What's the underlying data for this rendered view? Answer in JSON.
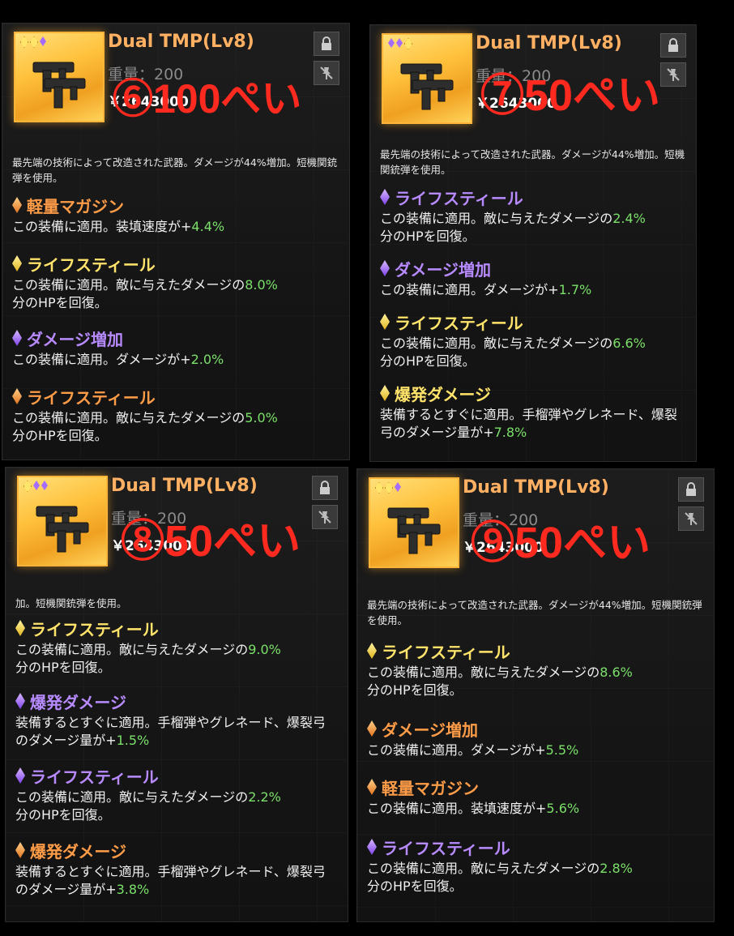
{
  "cards": [
    {
      "name": "Dual TMP(Lv8)",
      "weight": "重量：200",
      "price": "￥2643000",
      "annotation": "⑥100ぺい",
      "description": "最先端の技術によって改造された武器。ダメージが44%増加。短機関銃弾を使用。",
      "perks": [
        {
          "title": "軽量マガジン",
          "gem": "orange",
          "pre": "この装備に適用。装填速度が+",
          "value": "4.4%",
          "post": ""
        },
        {
          "title": "ライフスティール",
          "gem": "yellow",
          "pre": "この装備に適用。敵に与えたダメージの",
          "value": "8.0%",
          "post": "分のHPを回復。"
        },
        {
          "title": "ダメージ増加",
          "gem": "purple",
          "pre": "この装備に適用。ダメージが+",
          "value": "2.0%",
          "post": ""
        },
        {
          "title": "ライフスティール",
          "gem": "orange",
          "pre": "この装備に適用。敵に与えたダメージの",
          "value": "5.0%",
          "post": "分のHPを回復。"
        }
      ]
    },
    {
      "name": "Dual TMP(Lv8)",
      "weight": "重量：200",
      "price": "￥2643000",
      "annotation": "⑦50ぺい",
      "description": "最先端の技術によって改造された武器。ダメージが44%増加。短機関銃弾を使用。",
      "perks": [
        {
          "title": "ライフスティール",
          "gem": "purple",
          "pre": "この装備に適用。敵に与えたダメージの",
          "value": "2.4%",
          "post": "分のHPを回復。"
        },
        {
          "title": "ダメージ増加",
          "gem": "purple",
          "pre": "この装備に適用。ダメージが+",
          "value": "1.7%",
          "post": ""
        },
        {
          "title": "ライフスティール",
          "gem": "yellow",
          "pre": "この装備に適用。敵に与えたダメージの",
          "value": "6.6%",
          "post": "分のHPを回復。"
        },
        {
          "title": "爆発ダメージ",
          "gem": "yellow",
          "pre": "装備するとすぐに適用。手榴弾やグレネード、爆裂弓のダメージ量が+",
          "value": "7.8%",
          "post": ""
        }
      ]
    },
    {
      "name": "Dual TMP(Lv8)",
      "weight": "重量：200",
      "price": "￥2643000",
      "annotation": "⑧50ぺい",
      "description": "加。短機関銃弾を使用。",
      "perks": [
        {
          "title": "ライフスティール",
          "gem": "yellow",
          "pre": "この装備に適用。敵に与えたダメージの",
          "value": "9.0%",
          "post": "分のHPを回復。"
        },
        {
          "title": "爆発ダメージ",
          "gem": "purple",
          "pre": "装備するとすぐに適用。手榴弾やグレネード、爆裂弓のダメージ量が+",
          "value": "1.5%",
          "post": ""
        },
        {
          "title": "ライフスティール",
          "gem": "purple",
          "pre": "この装備に適用。敵に与えたダメージの",
          "value": "2.2%",
          "post": "分のHPを回復。"
        },
        {
          "title": "爆発ダメージ",
          "gem": "orange",
          "pre": "装備するとすぐに適用。手榴弾やグレネード、爆裂弓のダメージ量が+",
          "value": "3.8%",
          "post": ""
        }
      ]
    },
    {
      "name": "Dual TMP(Lv8)",
      "weight": "重量：200",
      "price": "￥2643000",
      "annotation": "⑨50ぺい",
      "description": "最先端の技術によって改造された武器。ダメージが44%増加。短機関銃弾を使用。",
      "perks": [
        {
          "title": "ライフスティール",
          "gem": "yellow",
          "pre": "この装備に適用。敵に与えたダメージの",
          "value": "8.6%",
          "post": "分のHPを回復。"
        },
        {
          "title": "ダメージ増加",
          "gem": "orange",
          "pre": "この装備に適用。ダメージが+",
          "value": "5.5%",
          "post": ""
        },
        {
          "title": "軽量マガジン",
          "gem": "orange",
          "pre": "この装備に適用。装填速度が+",
          "value": "5.6%",
          "post": ""
        },
        {
          "title": "ライフスティール",
          "gem": "purple",
          "pre": "この装備に適用。敵に与えたダメージの",
          "value": "2.8%",
          "post": "分のHPを回復。"
        }
      ]
    }
  ],
  "colors": {
    "orange": "#ff9c47",
    "yellow": "#ffe36a",
    "purple": "#b78bff",
    "value_green": "#7be06a",
    "annotation_red": "#ff2a1f"
  }
}
